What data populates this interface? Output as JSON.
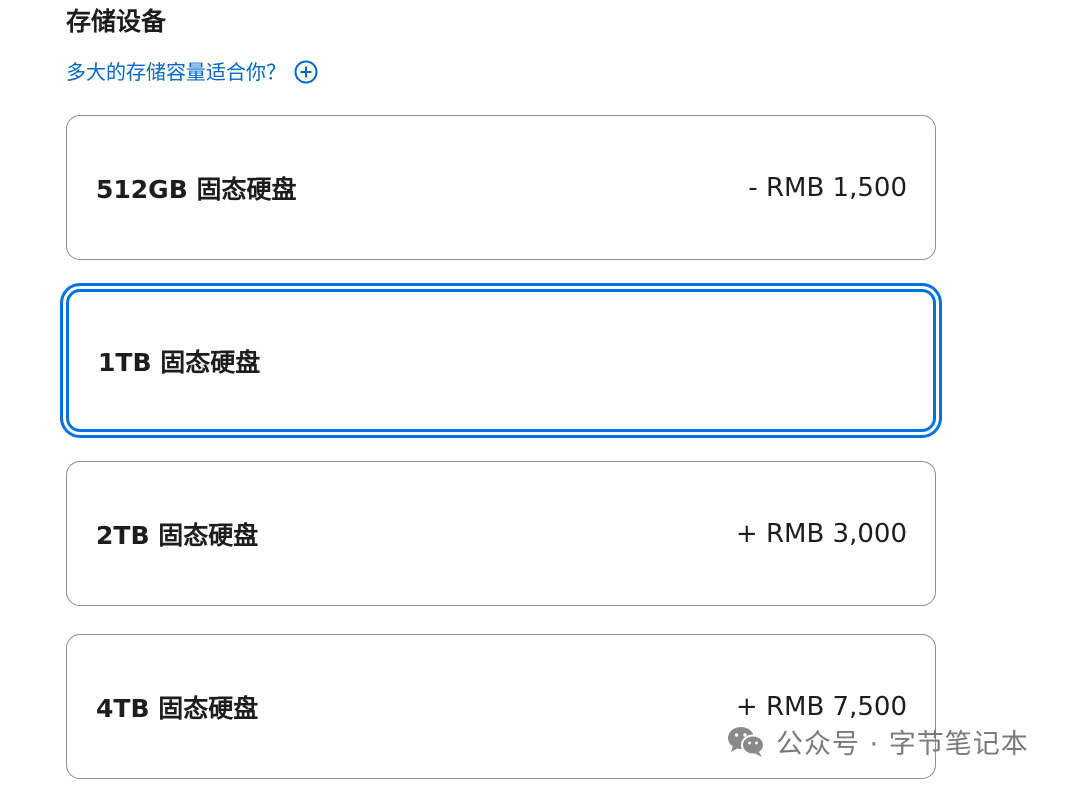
{
  "section": {
    "title": "存储设备",
    "help_link": "多大的存储容量适合你？",
    "help_icon": "plus-circle-icon",
    "accent_color": "#0066cc"
  },
  "options": [
    {
      "name": "512GB 固态硬盘",
      "price": "- RMB 1,500",
      "selected": false
    },
    {
      "name": "1TB 固态硬盘",
      "price": "",
      "selected": true
    },
    {
      "name": "2TB 固态硬盘",
      "price": "+ RMB 3,000",
      "selected": false
    },
    {
      "name": "4TB 固态硬盘",
      "price": "+ RMB 7,500",
      "selected": false
    }
  ],
  "watermark": {
    "icon": "wechat-icon",
    "text": "公众号 · 字节笔记本"
  }
}
